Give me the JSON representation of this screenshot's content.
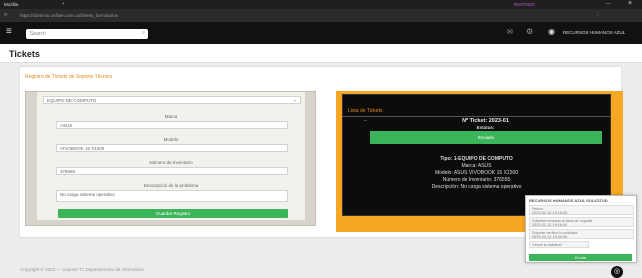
{
  "browser": {
    "tab_title": "Mozilla",
    "url": "https://dominio.onfiwe.com.co/tickets_formularios",
    "profile_label": "INVITADO",
    "window_min": "—",
    "window_close": "×"
  },
  "appbar": {
    "search_placeholder": "Search",
    "user_name": "RECURSOS HUMANOS AZUL"
  },
  "page": {
    "title": "Tickets",
    "form_subtitle": "Registro de Tickets de Soporte Técnico"
  },
  "form": {
    "type_select_value": "EQUIPO DE COMPUTO",
    "brand_label": "Marca",
    "brand_value": "ASUS",
    "model_label": "Modelo",
    "model_value": "VIVOBOOK 15 X1500",
    "inventory_label": "Número de Inventario",
    "inventory_value": "376555",
    "problem_label": "Descripción de la problema",
    "problem_value": "No carga sistema operativo",
    "submit_label": "Guardar Registro"
  },
  "ticket": {
    "heading": "Lista de Tickets",
    "number": "Nº Ticket: 2023-01",
    "status_label": "Estatus:",
    "status_value": "Enviado",
    "type_line": "Tipo: 1-EQUIPO DE COMPUTO",
    "brand_line": "Marca: ASUS",
    "model_line": "Modelo: ASUS VIVOBOOK 15 X1500",
    "inventory_line": "Número de Inventario: 376555",
    "description_line": "Descripción: No carga sistema operativo"
  },
  "widget": {
    "title": "RECURSOS HUMANOS AZUL SOLICITUD",
    "field1_label": "Fecha",
    "field1_value": "2023-02-12 19:15:00",
    "field2_label": "Solicitud enviada al área de soporte",
    "field2_value": "2023-02-12 19:16:00",
    "field3_label": "Soporte verificó tu solicitud",
    "field3_value": "2023-02-12 19:20:00",
    "field4_label": "Cerrar la solicitud",
    "button_label": "Enviar"
  },
  "footer": {
    "text": "Copyright © 2023 — Soporte TI: Departamento de Informática"
  },
  "colors": {
    "accent_orange": "#f5a623",
    "green_button": "#3cb55a",
    "dark_panel": "#0c0c0c"
  }
}
